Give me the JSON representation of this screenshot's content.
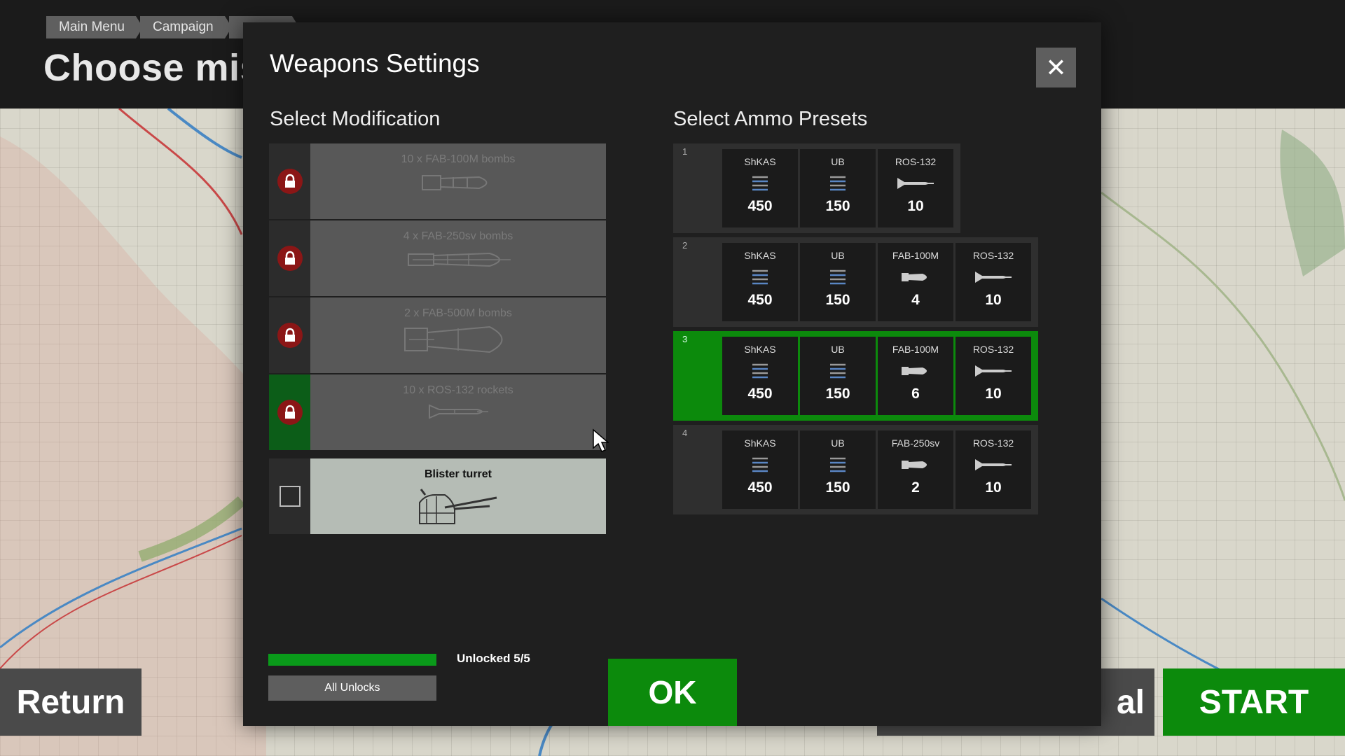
{
  "breadcrumb": [
    "Main Menu",
    "Campaign",
    ""
  ],
  "page_title": "Choose miss",
  "buttons": {
    "return": "Return",
    "start": "START",
    "partial": "al",
    "ok": "OK",
    "all_unlocks": "All Unlocks"
  },
  "modal": {
    "title": "Weapons Settings",
    "close_glyph": "✕",
    "mods_title": "Select Modification",
    "presets_title": "Select Ammo Presets"
  },
  "modifications": [
    {
      "label": "10 x FAB-100M bombs",
      "icon": "bomb-icon",
      "locked": true
    },
    {
      "label": "4 x FAB-250sv bombs",
      "icon": "bomb-icon",
      "locked": true
    },
    {
      "label": "2 x FAB-500M bombs",
      "icon": "bomb-icon",
      "locked": true
    },
    {
      "label": "10 x ROS-132 rockets",
      "icon": "rocket-icon",
      "locked": true,
      "highlighted": true
    },
    {
      "label": "Blister turret",
      "icon": "turret-icon",
      "locked": false,
      "selected": true
    }
  ],
  "unlock": {
    "text": "Unlocked 5/5",
    "fraction": 1.0
  },
  "presets": [
    {
      "num": "1",
      "items": [
        {
          "name": "ShKAS",
          "count": "450",
          "icon": "bullets-icon"
        },
        {
          "name": "UB",
          "count": "150",
          "icon": "bullets-icon"
        },
        {
          "name": "ROS-132",
          "count": "10",
          "icon": "rocket-icon"
        }
      ]
    },
    {
      "num": "2",
      "items": [
        {
          "name": "ShKAS",
          "count": "450",
          "icon": "bullets-icon"
        },
        {
          "name": "UB",
          "count": "150",
          "icon": "bullets-icon"
        },
        {
          "name": "FAB-100M",
          "count": "4",
          "icon": "bomb-icon"
        },
        {
          "name": "ROS-132",
          "count": "10",
          "icon": "rocket-icon"
        }
      ]
    },
    {
      "num": "3",
      "selected": true,
      "items": [
        {
          "name": "ShKAS",
          "count": "450",
          "icon": "bullets-icon"
        },
        {
          "name": "UB",
          "count": "150",
          "icon": "bullets-icon"
        },
        {
          "name": "FAB-100M",
          "count": "6",
          "icon": "bomb-icon"
        },
        {
          "name": "ROS-132",
          "count": "10",
          "icon": "rocket-icon"
        }
      ]
    },
    {
      "num": "4",
      "items": [
        {
          "name": "ShKAS",
          "count": "450",
          "icon": "bullets-icon"
        },
        {
          "name": "UB",
          "count": "150",
          "icon": "bullets-icon"
        },
        {
          "name": "FAB-250sv",
          "count": "2",
          "icon": "bomb-icon"
        },
        {
          "name": "ROS-132",
          "count": "10",
          "icon": "rocket-icon"
        }
      ]
    }
  ],
  "colors": {
    "accent_green": "#0c8a0c",
    "lock_red": "#8b1616"
  }
}
